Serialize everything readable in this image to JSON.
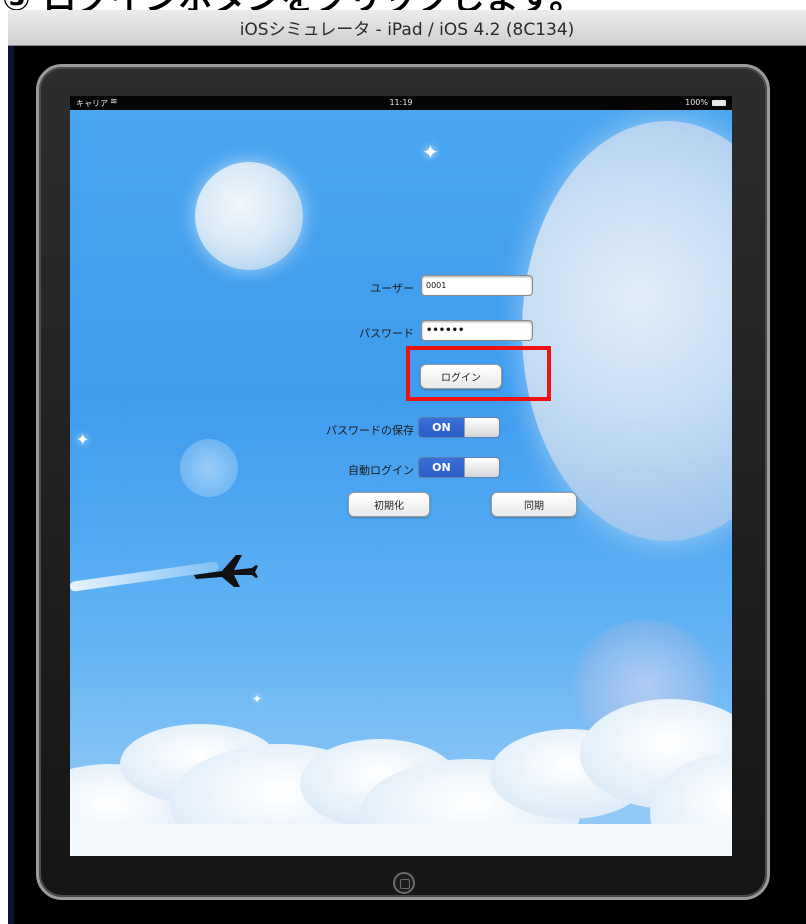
{
  "instruction": {
    "text": "③ ログインボタンをクリックします。"
  },
  "simulator": {
    "title": "iOSシミュレータ - iPad / iOS 4.2 (8C134)"
  },
  "status_bar": {
    "carrier": "キャリア",
    "wifi_icon": "wifi-icon",
    "time": "11:19",
    "battery": "100%",
    "battery_icon": "battery-icon"
  },
  "login_form": {
    "user_label": "ユーザー",
    "user_value": "0001",
    "password_label": "パスワード",
    "password_value": "••••••",
    "login_button": "ログイン",
    "save_password_label": "パスワードの保存",
    "save_password_state": "ON",
    "auto_login_label": "自動ログイン",
    "auto_login_state": "ON",
    "reset_button": "初期化",
    "sync_button": "同期"
  },
  "annotation": {
    "highlight_color": "#ee1111",
    "highlight_target": "login-button"
  },
  "colors": {
    "sky_top": "#4aa6f0",
    "switch_on": "#2b5ec8"
  }
}
